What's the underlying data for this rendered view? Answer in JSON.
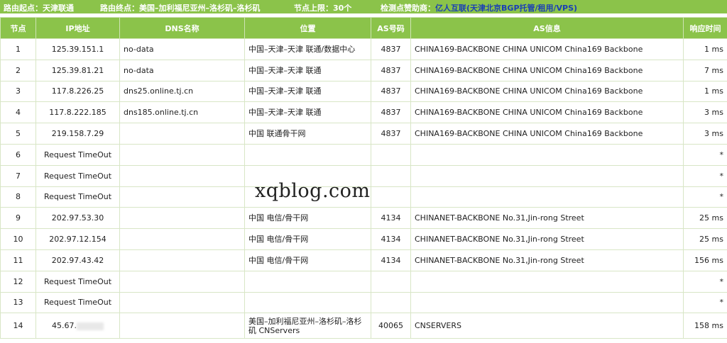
{
  "header": {
    "origin_label": "路由起点：",
    "origin_value": "天津联通",
    "dest_label": "路由终点：",
    "dest_value": "美国–加利福尼亚州–洛杉矶–洛杉矶",
    "hop_limit_label": "节点上限：",
    "hop_limit_value": "30个",
    "sponsor_label": "检测点赞助商：",
    "sponsor_name": "亿人互联",
    "sponsor_note": "(天津北京BGP托管/租用/VPS)"
  },
  "columns": [
    "节点",
    "IP地址",
    "DNS名称",
    "位置",
    "AS号码",
    "AS信息",
    "响应时间"
  ],
  "rows": [
    {
      "hop": "1",
      "ip": "125.39.151.1",
      "dns": "no-data",
      "location": "中国–天津–天津 联通/数据中心",
      "asn": "4837",
      "asinfo": "CHINA169-BACKBONE CHINA UNICOM China169 Backbone",
      "time": "1 ms"
    },
    {
      "hop": "2",
      "ip": "125.39.81.21",
      "dns": "no-data",
      "location": "中国–天津–天津 联通",
      "asn": "4837",
      "asinfo": "CHINA169-BACKBONE CHINA UNICOM China169 Backbone",
      "time": "7 ms"
    },
    {
      "hop": "3",
      "ip": "117.8.226.25",
      "dns": "dns25.online.tj.cn",
      "location": "中国–天津–天津 联通",
      "asn": "4837",
      "asinfo": "CHINA169-BACKBONE CHINA UNICOM China169 Backbone",
      "time": "1 ms"
    },
    {
      "hop": "4",
      "ip": "117.8.222.185",
      "dns": "dns185.online.tj.cn",
      "location": "中国–天津–天津 联通",
      "asn": "4837",
      "asinfo": "CHINA169-BACKBONE CHINA UNICOM China169 Backbone",
      "time": "3 ms"
    },
    {
      "hop": "5",
      "ip": "219.158.7.29",
      "dns": "",
      "location": "中国 联通骨干网",
      "asn": "4837",
      "asinfo": "CHINA169-BACKBONE CHINA UNICOM China169 Backbone",
      "time": "3 ms"
    },
    {
      "hop": "6",
      "ip": "Request TimeOut",
      "dns": "",
      "location": "",
      "asn": "",
      "asinfo": "",
      "time": "*"
    },
    {
      "hop": "7",
      "ip": "Request TimeOut",
      "dns": "",
      "location": "",
      "asn": "",
      "asinfo": "",
      "time": "*"
    },
    {
      "hop": "8",
      "ip": "Request TimeOut",
      "dns": "",
      "location": "",
      "asn": "",
      "asinfo": "",
      "time": "*"
    },
    {
      "hop": "9",
      "ip": "202.97.53.30",
      "dns": "",
      "location": "中国 电信/骨干网",
      "asn": "4134",
      "asinfo": "CHINANET-BACKBONE No.31,Jin-rong Street",
      "time": "25 ms"
    },
    {
      "hop": "10",
      "ip": "202.97.12.154",
      "dns": "",
      "location": "中国 电信/骨干网",
      "asn": "4134",
      "asinfo": "CHINANET-BACKBONE No.31,Jin-rong Street",
      "time": "25 ms"
    },
    {
      "hop": "11",
      "ip": "202.97.43.42",
      "dns": "",
      "location": "中国 电信/骨干网",
      "asn": "4134",
      "asinfo": "CHINANET-BACKBONE No.31,Jin-rong Street",
      "time": "156 ms"
    },
    {
      "hop": "12",
      "ip": "Request TimeOut",
      "dns": "",
      "location": "",
      "asn": "",
      "asinfo": "",
      "time": "*"
    },
    {
      "hop": "13",
      "ip": "Request TimeOut",
      "dns": "",
      "location": "",
      "asn": "",
      "asinfo": "",
      "time": "*"
    },
    {
      "hop": "14",
      "ip": "45.67.",
      "dns": "",
      "location": "美国–加利福尼亚州–洛杉矶–洛杉矶 CNServers",
      "asn": "40065",
      "asinfo": "CNSERVERS",
      "time": "158 ms"
    }
  ],
  "watermark": "xqblog.com",
  "colors": {
    "header_green": "#8bc34a",
    "sponsor_blue": "#1a3fb5"
  }
}
